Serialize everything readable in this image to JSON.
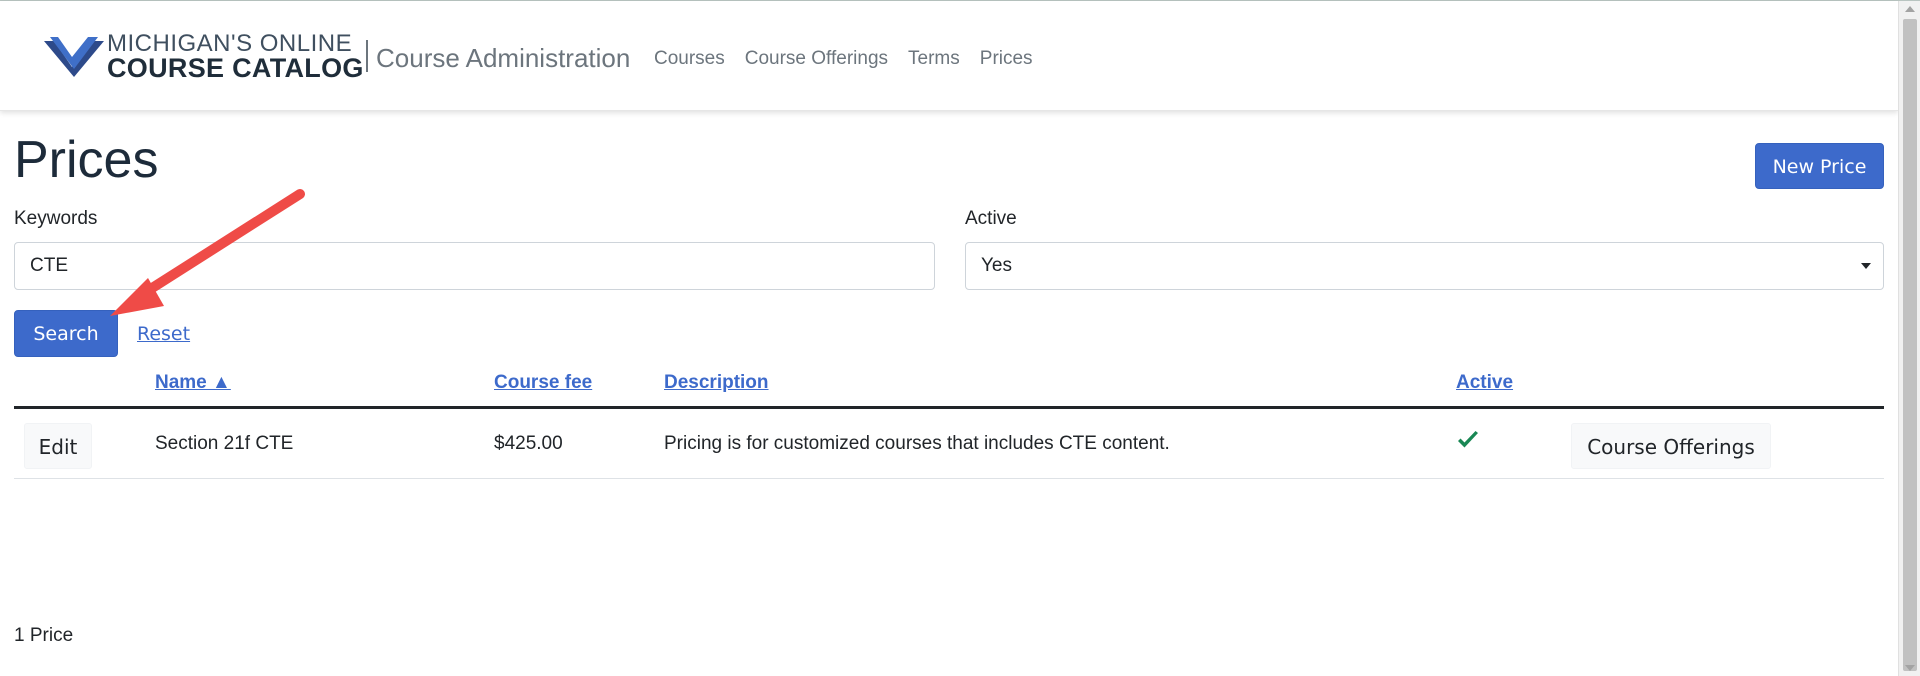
{
  "brand": {
    "line1": "MICHIGAN'S ONLINE",
    "line2": "COURSE CATALOG",
    "app_title": "Course Administration"
  },
  "nav": {
    "items": [
      {
        "label": "Courses"
      },
      {
        "label": "Course Offerings"
      },
      {
        "label": "Terms"
      },
      {
        "label": "Prices"
      }
    ]
  },
  "page": {
    "title": "Prices",
    "new_button": "New Price"
  },
  "filters": {
    "keywords_label": "Keywords",
    "keywords_value": "CTE",
    "active_label": "Active",
    "active_value": "Yes",
    "search_button": "Search",
    "reset_link": "Reset"
  },
  "table": {
    "columns": {
      "name": "Name ▲",
      "course_fee": "Course fee",
      "description": "Description",
      "active": "Active"
    },
    "rows": [
      {
        "edit": "Edit",
        "name": "Section 21f CTE",
        "course_fee": "$425.00",
        "description": "Pricing is for customized courses that includes CTE content.",
        "active": true,
        "offerings_button": "Course Offerings"
      }
    ]
  },
  "footer": {
    "count": "1 Price"
  },
  "colors": {
    "primary": "#3d6acb",
    "check": "#198754",
    "annotation_arrow": "#ef4b47"
  }
}
